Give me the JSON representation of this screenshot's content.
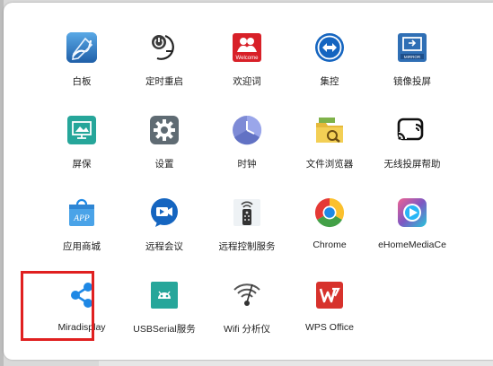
{
  "apps": [
    {
      "label": "白板",
      "icon": "whiteboard-icon"
    },
    {
      "label": "定时重启",
      "icon": "timer-power-icon"
    },
    {
      "label": "欢迎词",
      "icon": "welcome-icon"
    },
    {
      "label": "集控",
      "icon": "central-control-icon"
    },
    {
      "label": "镜像投屏",
      "icon": "mirror-cast-icon"
    },
    {
      "label": "屏保",
      "icon": "screensaver-icon"
    },
    {
      "label": "设置",
      "icon": "settings-gear-icon"
    },
    {
      "label": "时钟",
      "icon": "clock-icon"
    },
    {
      "label": "文件浏览器",
      "icon": "file-browser-icon"
    },
    {
      "label": "无线投屏帮助",
      "icon": "wireless-cast-help-icon"
    },
    {
      "label": "应用商城",
      "icon": "app-store-icon"
    },
    {
      "label": "远程会议",
      "icon": "remote-meeting-icon"
    },
    {
      "label": "远程控制服务",
      "icon": "remote-control-service-icon"
    },
    {
      "label": "Chrome",
      "icon": "chrome-icon"
    },
    {
      "label": "eHomeMediaCe",
      "icon": "ehome-media-icon"
    },
    {
      "label": "Miradisplay",
      "icon": "share-icon"
    },
    {
      "label": "USBSerial服务",
      "icon": "android-usb-icon"
    },
    {
      "label": "Wifi 分析仪",
      "icon": "wifi-analyzer-icon"
    },
    {
      "label": "WPS Office",
      "icon": "wps-office-icon"
    }
  ],
  "icon_texts": {
    "welcome": "Welcome",
    "mirror": "MIRROR",
    "app_store": "APP"
  },
  "selected_app": "Miradisplay",
  "colors": {
    "highlight": "#e02020",
    "blue": "#1e88e5",
    "teal": "#26a69a",
    "wps_red": "#d7322c"
  }
}
